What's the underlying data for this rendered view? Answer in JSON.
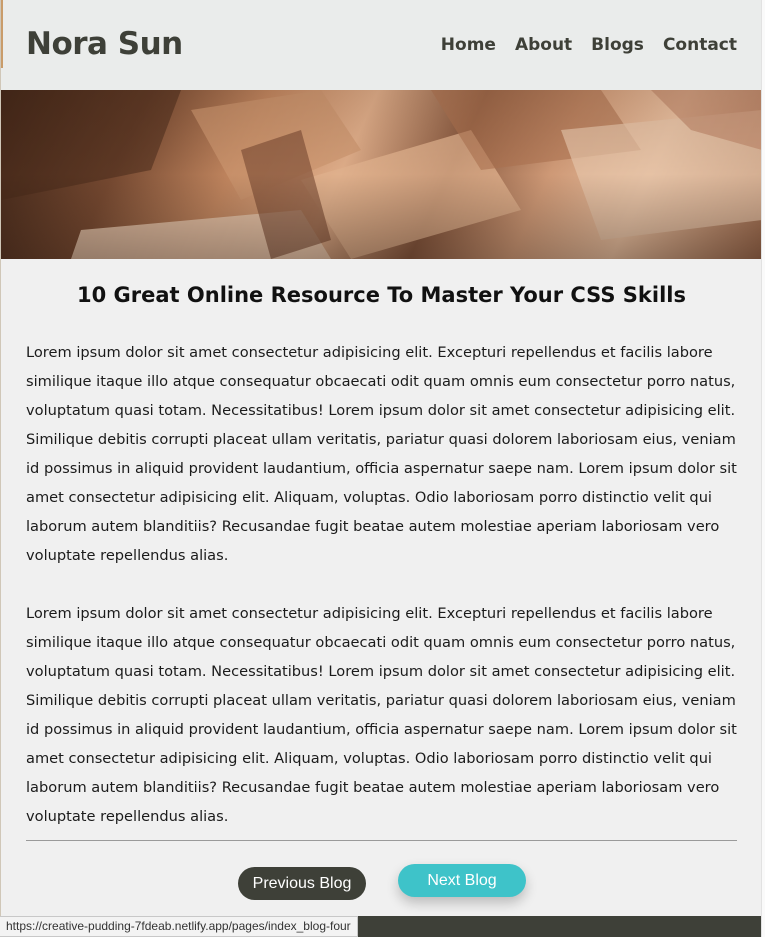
{
  "header": {
    "brand": "Nora Sun",
    "nav": [
      "Home",
      "About",
      "Blogs",
      "Contact"
    ]
  },
  "hero": {
    "description": "",
    "colors": [
      "#3d2417",
      "#c88b63",
      "#e7b48f"
    ]
  },
  "article": {
    "title": "10 Great Online Resource To Master Your CSS Skills",
    "paragraphs": [
      "Lorem ipsum dolor sit amet consectetur adipisicing elit. Excepturi repellendus et facilis labore similique itaque illo atque consequatur obcaecati odit quam omnis eum consectetur porro natus, voluptatum quasi totam. Necessitatibus! Lorem ipsum dolor sit amet consectetur adipisicing elit. Similique debitis corrupti placeat ullam veritatis, pariatur quasi dolorem laboriosam eius, veniam id possimus in aliquid provident laudantium, officia aspernatur saepe nam. Lorem ipsum dolor sit amet consectetur adipisicing elit. Aliquam, voluptas. Odio laboriosam porro distinctio velit qui laborum autem blanditiis? Recusandae fugit beatae autem molestiae aperiam laboriosam vero voluptate repellendus alias.",
      "Lorem ipsum dolor sit amet consectetur adipisicing elit. Excepturi repellendus et facilis labore similique itaque illo atque consequatur obcaecati odit quam omnis eum consectetur porro natus, voluptatum quasi totam. Necessitatibus! Lorem ipsum dolor sit amet consectetur adipisicing elit. Similique debitis corrupti placeat ullam veritatis, pariatur quasi dolorem laboriosam eius, veniam id possimus in aliquid provident laudantium, officia aspernatur saepe nam. Lorem ipsum dolor sit amet consectetur adipisicing elit. Aliquam, voluptas. Odio laboriosam porro distinctio velit qui laborum autem blanditiis? Recusandae fugit beatae autem molestiae aperiam laboriosam vero voluptate repellendus alias."
    ]
  },
  "pagination": {
    "prev_label": "Previous Blog",
    "next_label": "Next Blog"
  },
  "status_bar": {
    "url": "https://creative-pudding-7fdeab.netlify.app/pages/index_blog-four"
  },
  "colors": {
    "brand": "#3e4038",
    "accent": "#3ec3c9",
    "background": "#f0f0f0"
  }
}
